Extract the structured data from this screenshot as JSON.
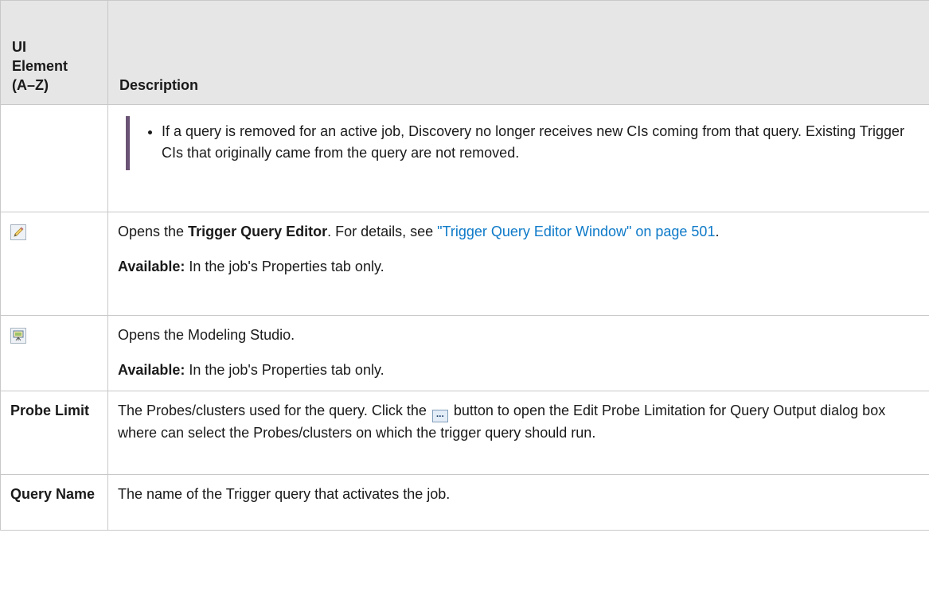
{
  "header": {
    "col1": "UI Element (A–Z)",
    "col1_lines": [
      "UI",
      "Element",
      "(A–Z)"
    ],
    "col2": "Description"
  },
  "rows": {
    "note_row": {
      "element": "",
      "bullet": "If a query is removed for an active job, Discovery no longer receives new CIs coming from that query. Existing Trigger CIs that originally came from the query are not removed."
    },
    "edit_row": {
      "icon": "pencil-edit-icon",
      "text_before": "Opens the ",
      "bold": "Trigger Query Editor",
      "text_after": ". For details, see ",
      "link": "\"Trigger Query Editor Window\" on page 501",
      "end": ".",
      "avail_label": "Available:",
      "avail_text": " In the job's Properties tab only."
    },
    "studio_row": {
      "icon": "modeling-studio-icon",
      "text": "Opens the Modeling Studio.",
      "avail_label": "Available:",
      "avail_text": " In the job's Properties tab only."
    },
    "probe_row": {
      "element": "Probe Limit",
      "text_before": "The Probes/clusters used for the query. Click the ",
      "button_icon": "ellipsis-button-icon",
      "button_glyph": "...",
      "text_after": " button to open the Edit Probe Limitation for Query Output dialog box where can select the Probes/clusters on which the trigger query should run."
    },
    "query_row": {
      "element": "Query Name",
      "text": "The name of the Trigger query that activates the job."
    }
  }
}
